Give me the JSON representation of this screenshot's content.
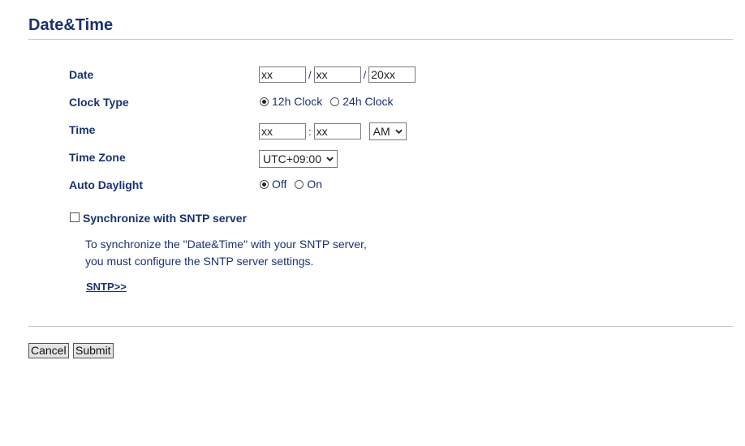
{
  "page": {
    "title": "Date&Time"
  },
  "date": {
    "label": "Date",
    "month": "xx",
    "day": "xx",
    "year": "20xx",
    "separator": "/"
  },
  "clock_type": {
    "label": "Clock Type",
    "options": [
      "12h Clock",
      "24h Clock"
    ],
    "selected": "12h Clock"
  },
  "time": {
    "label": "Time",
    "hour": "xx",
    "minute": "xx",
    "separator": ":",
    "ampm": "AM"
  },
  "time_zone": {
    "label": "Time Zone",
    "value": "UTC+09:00"
  },
  "auto_daylight": {
    "label": "Auto Daylight",
    "options": [
      "Off",
      "On"
    ],
    "selected": "Off"
  },
  "sntp": {
    "checkbox_label": "Synchronize with SNTP server",
    "checked": false,
    "info_line1": "To synchronize the \"Date&Time\" with your SNTP server,",
    "info_line2": "you must configure the SNTP server settings.",
    "link": "SNTP>>"
  },
  "buttons": {
    "cancel": "Cancel",
    "submit": "Submit"
  },
  "colors": {
    "label": "#1a3271",
    "rule": "#c8c8c8",
    "button_bg": "#e4e4e4"
  },
  "icons": {
    "dropdown": "chevron-down-icon"
  }
}
